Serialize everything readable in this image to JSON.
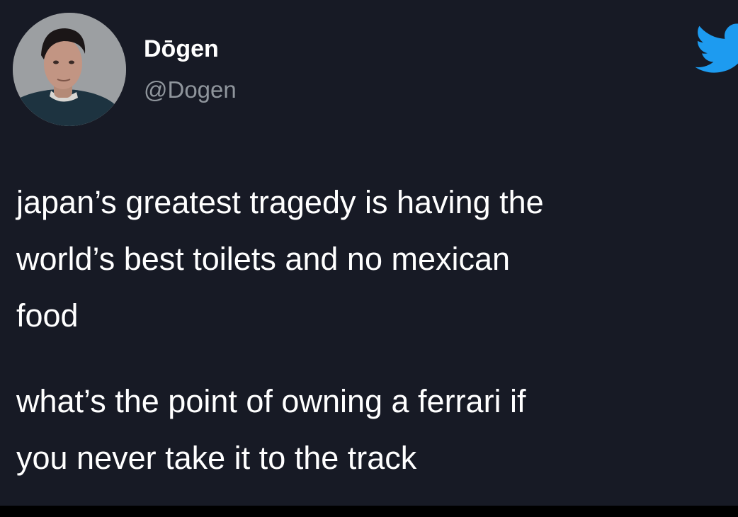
{
  "tweet": {
    "author": {
      "display_name": "Dōgen",
      "handle": "@Dogen",
      "avatar": "profile-photo"
    },
    "brand_icon": "twitter-bird-icon",
    "accent_color": "#1d9bf0",
    "background_color": "#171a25",
    "text_color": "#ffffff",
    "handle_color": "#8f959c",
    "paragraphs": [
      {
        "lines": [
          "japan’s greatest tragedy is having the",
          "world’s best toilets and no mexican",
          "food"
        ]
      },
      {
        "lines": [
          "what’s the point of owning a ferrari if",
          "you never take it to the track"
        ]
      }
    ]
  }
}
